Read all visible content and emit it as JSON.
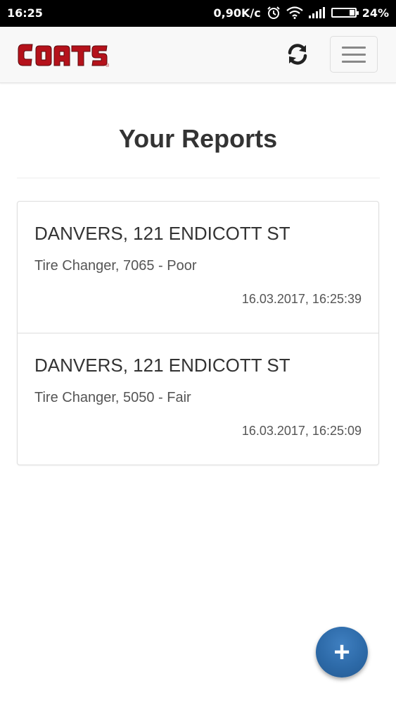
{
  "status_bar": {
    "time": "16:25",
    "network_speed": "0,90K/c",
    "battery_level": "24%",
    "battery_fraction": 0.24,
    "icons": [
      "alarm-icon",
      "wifi-icon",
      "signal-icon",
      "battery-icon"
    ]
  },
  "navbar": {
    "logo_text": "COATS",
    "logo_mark": "®",
    "refresh_icon": "refresh-icon",
    "menu_icon": "hamburger-menu-icon"
  },
  "page": {
    "title": "Your Reports"
  },
  "reports": [
    {
      "location": "DANVERS, 121 ENDICOTT ST",
      "description": "Tire Changer, 7065 - Poor",
      "timestamp": "16.03.2017, 16:25:39"
    },
    {
      "location": "DANVERS, 121 ENDICOTT ST",
      "description": "Tire Changer, 5050 - Fair",
      "timestamp": "16.03.2017, 16:25:09"
    }
  ],
  "fab": {
    "label": "+",
    "icon": "plus-icon"
  },
  "colors": {
    "brand_red": "#b5121b",
    "fab_blue": "#2d6aa8",
    "navbar_bg": "#f8f8f8",
    "text": "#333333"
  }
}
